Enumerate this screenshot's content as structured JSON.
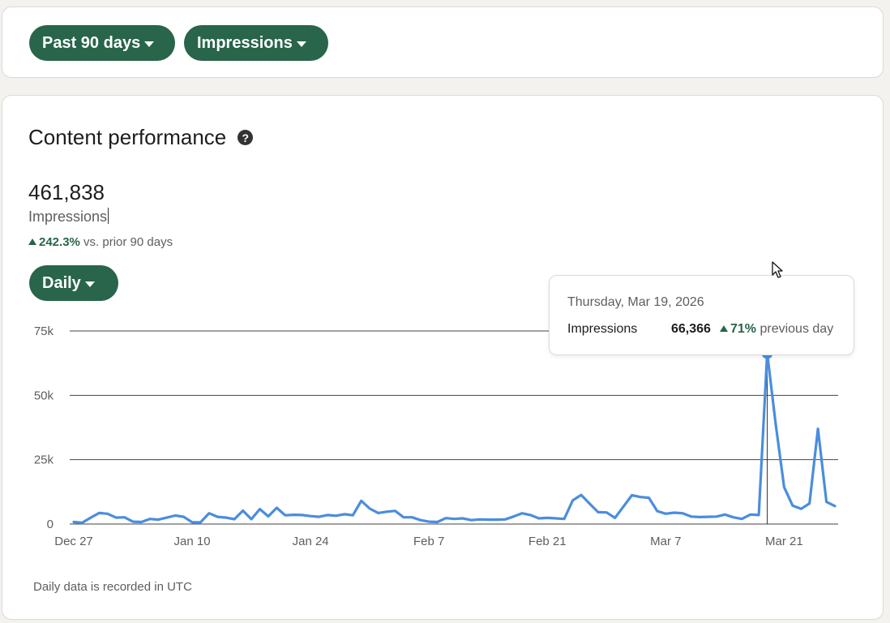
{
  "filters": {
    "range_label": "Past 90 days",
    "metric_label": "Impressions"
  },
  "panel": {
    "title": "Content performance",
    "help_glyph": "?",
    "total": "461,838",
    "total_label": "Impressions",
    "delta_pct": "242.3%",
    "delta_suffix": " vs. prior 90 days",
    "granularity_label": "Daily",
    "footnote": "Daily data is recorded in UTC"
  },
  "tooltip": {
    "date": "Thursday, Mar 19, 2026",
    "metric": "Impressions",
    "value": "66,366",
    "change_pct": "71%",
    "change_suffix": " previous day"
  },
  "colors": {
    "accent": "#28654a",
    "line": "#4a8ddd"
  },
  "chart_data": {
    "type": "line",
    "x_tick_labels": [
      "Dec 27",
      "Jan 10",
      "Jan 24",
      "Feb 7",
      "Feb 21",
      "Mar 7",
      "Mar 21"
    ],
    "y_tick_labels": [
      "75k",
      "50k",
      "25k",
      "0"
    ],
    "y_ticks": [
      75000,
      50000,
      25000,
      0
    ],
    "ylim": [
      0,
      75000
    ],
    "x_start_date": "2025-12-27",
    "highlight_index": 82,
    "series": [
      {
        "values": [
          800,
          500,
          2500,
          4300,
          4000,
          2500,
          2600,
          900,
          800,
          2000,
          1700,
          2500,
          3300,
          2800,
          700,
          700,
          4200,
          2800,
          2500,
          1900,
          5200,
          1900,
          5800,
          3000,
          6300,
          3400,
          3600,
          3500,
          3100,
          2800,
          3500,
          3200,
          3800,
          3400,
          9000,
          6000,
          4300,
          4800,
          5100,
          2600,
          2600,
          1500,
          900,
          800,
          2300,
          2000,
          2200,
          1500,
          1800,
          1700,
          1700,
          1800,
          2900,
          4200,
          3500,
          2200,
          2400,
          2200,
          2000,
          9200,
          11300,
          7900,
          4600,
          4500,
          2400,
          6800,
          11200,
          10500,
          10200,
          5000,
          4000,
          4400,
          4200,
          2900,
          2700,
          2800,
          2900,
          3700,
          2600,
          2000,
          3700,
          3500,
          66366,
          38800,
          14300,
          7200,
          5900,
          8000,
          37000,
          8600,
          7000
        ]
      }
    ]
  }
}
